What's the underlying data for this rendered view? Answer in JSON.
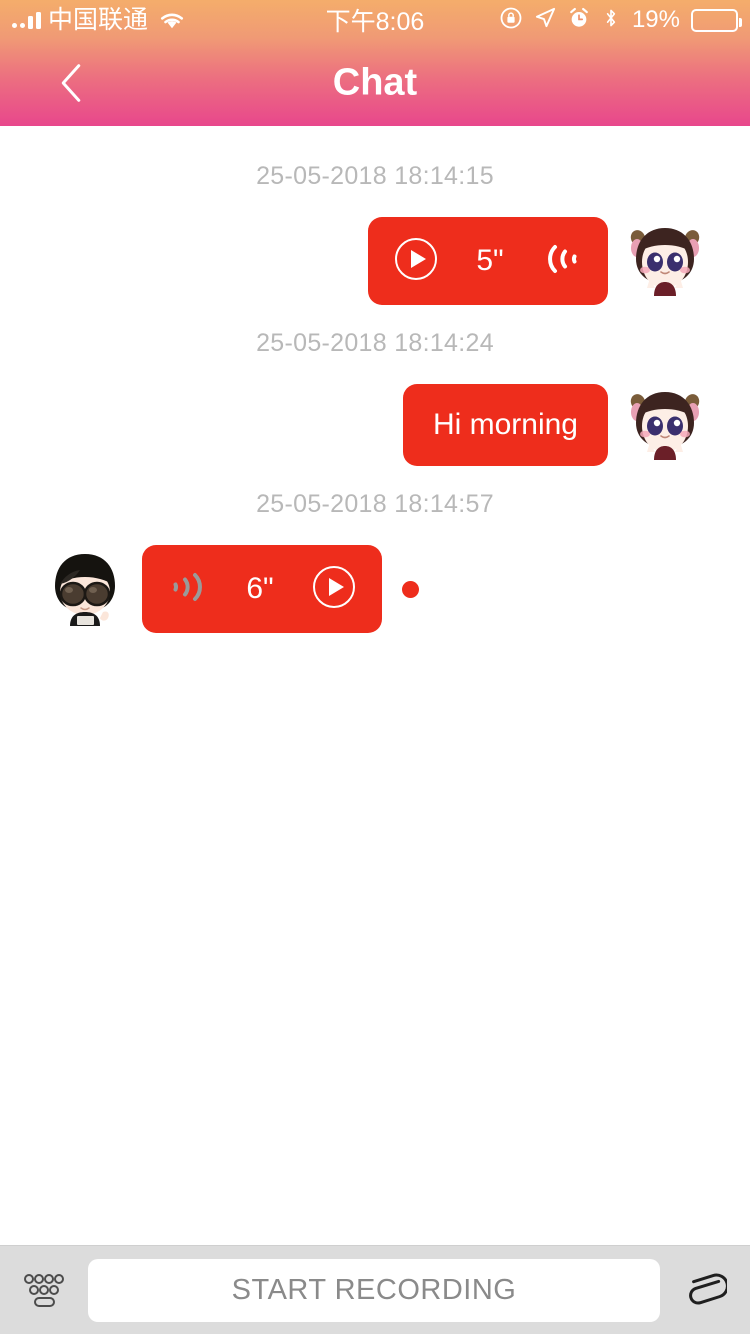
{
  "status_bar": {
    "carrier": "中国联通",
    "time": "下午8:06",
    "battery_percent": "19%",
    "battery_level": 19,
    "icons": [
      "signal-icon",
      "wifi-icon",
      "rotation-lock-icon",
      "location-arrow-icon",
      "alarm-clock-icon",
      "bluetooth-icon",
      "battery-icon"
    ]
  },
  "header": {
    "title": "Chat",
    "back_icon": "chevron-left-icon",
    "gradient_from": "#f4ad6b",
    "gradient_to": "#e8478c"
  },
  "theme": {
    "bubble_red": "#ee2d1c",
    "timestamp_gray": "#b8b8b8",
    "bottom_bar_gray": "#dcdcdc"
  },
  "messages": [
    {
      "timestamp": "25-05-2018 18:14:15",
      "direction": "outgoing",
      "type": "voice",
      "duration": "5\"",
      "avatar": "girl-avatar",
      "play_icon": "play-circle-icon",
      "wave_icon": "sound-wave-left-icon",
      "unread": false
    },
    {
      "timestamp": "25-05-2018 18:14:24",
      "direction": "outgoing",
      "type": "text",
      "text": "Hi morning",
      "avatar": "girl-avatar",
      "unread": false
    },
    {
      "timestamp": "25-05-2018 18:14:57",
      "direction": "incoming",
      "type": "voice",
      "duration": "6\"",
      "avatar": "boy-avatar",
      "play_icon": "play-circle-icon",
      "wave_icon": "sound-wave-right-icon",
      "unread": true
    }
  ],
  "bottom_bar": {
    "keyboard_icon": "keyboard-icon",
    "record_label": "START RECORDING",
    "attach_icon": "paperclip-icon"
  }
}
